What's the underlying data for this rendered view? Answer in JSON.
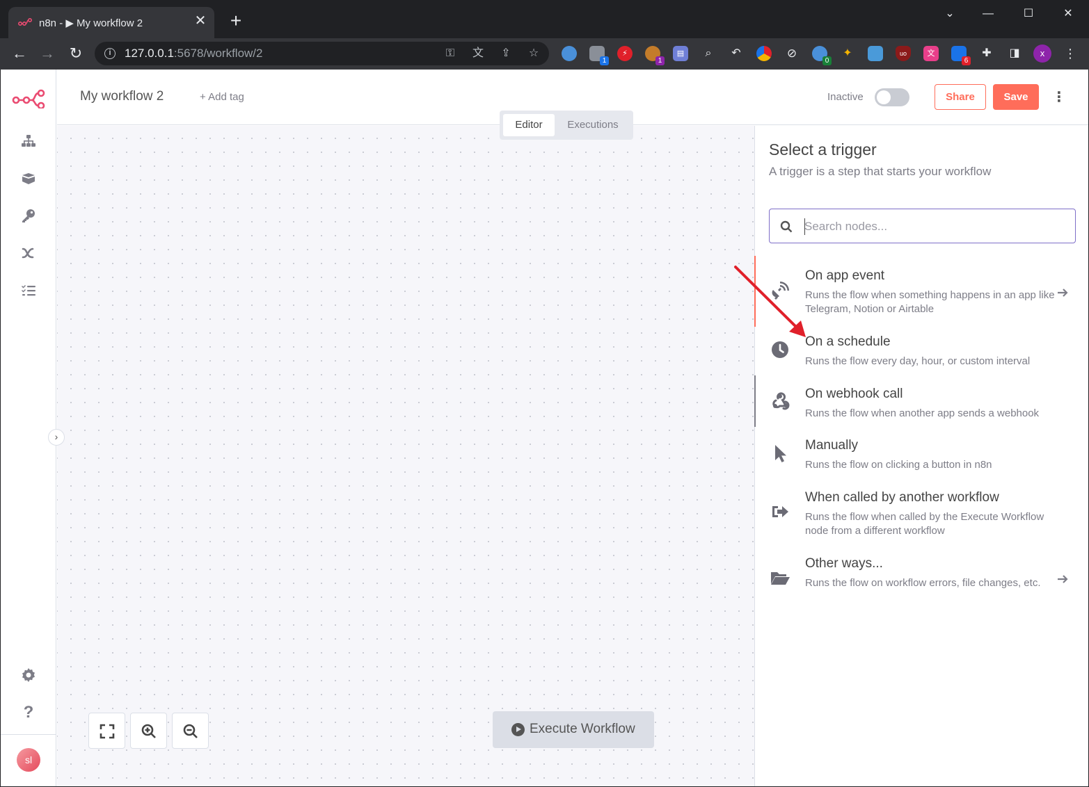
{
  "browser": {
    "tab_title": "n8n - ▶ My workflow 2",
    "tab_close": "✕",
    "new_tab": "+",
    "url_host": "127.0.0.1",
    "url_path": ":5678/workflow/2",
    "extension_badges": [
      "1",
      "1",
      "0",
      "6"
    ],
    "profile_initial": "x"
  },
  "header": {
    "workflow_name": "My workflow 2",
    "add_tag": "+ Add tag",
    "status_label": "Inactive",
    "active": false,
    "share_label": "Share",
    "save_label": "Save"
  },
  "view_switch": {
    "tabs": [
      {
        "label": "Editor",
        "active": true
      },
      {
        "label": "Executions",
        "active": false
      }
    ]
  },
  "sidebar": {
    "items": [
      "workflows-icon",
      "templates-icon",
      "credentials-icon",
      "variables-icon",
      "executions-icon"
    ],
    "bottom_items": [
      "settings-icon",
      "help-icon"
    ],
    "user_initials": "sl"
  },
  "canvas": {
    "execute_label": "Execute Workflow"
  },
  "panel": {
    "title": "Select a trigger",
    "subtitle": "A trigger is a step that starts your workflow",
    "search_placeholder": "Search nodes...",
    "items": [
      {
        "name": "On app event",
        "desc": "Runs the flow when something happens in an app like Telegram, Notion or Airtable",
        "icon": "satellite-icon",
        "has_arrow": true
      },
      {
        "name": "On a schedule",
        "desc": "Runs the flow every day, hour, or custom interval",
        "icon": "clock-icon",
        "has_arrow": false
      },
      {
        "name": "On webhook call",
        "desc": "Runs the flow when another app sends a webhook",
        "icon": "webhook-icon",
        "has_arrow": false
      },
      {
        "name": "Manually",
        "desc": "Runs the flow on clicking a button in n8n",
        "icon": "cursor-icon",
        "has_arrow": false
      },
      {
        "name": "When called by another workflow",
        "desc": "Runs the flow when called by the Execute Workflow node from a different workflow",
        "icon": "sign-in-icon",
        "has_arrow": false
      },
      {
        "name": "Other ways...",
        "desc": "Runs the flow on workflow errors, file changes, etc.",
        "icon": "folder-open-icon",
        "has_arrow": true
      }
    ]
  },
  "colors": {
    "accent": "#ff6d5a",
    "annotation_arrow": "#e0202a",
    "search_border": "#7e6ec8"
  }
}
